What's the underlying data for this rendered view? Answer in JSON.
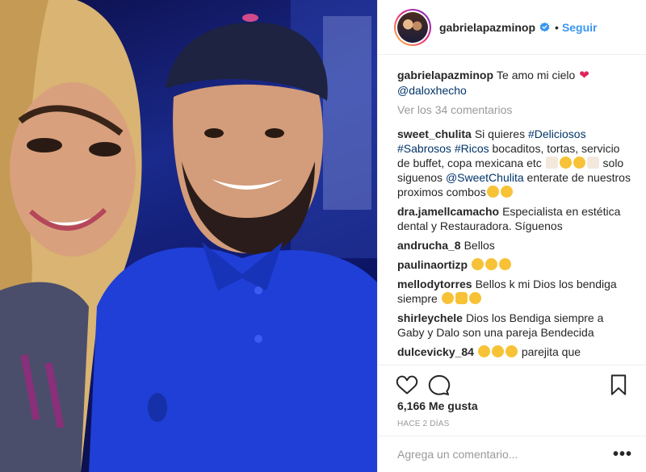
{
  "post": {
    "username": "gabrielapazminop",
    "separator": "•",
    "follow_label": "Seguir",
    "caption_text": "Te amo mi cielo",
    "caption_mention": "@daloxhecho",
    "view_all": "Ver los 34 comentarios",
    "likes": "6,166 Me gusta",
    "time_ago": "HACE 2 DÍAS",
    "add_comment_placeholder": "Agrega un comentario...",
    "more_label": "•••"
  },
  "comments": [
    {
      "user": "sweet_chulita",
      "parts": [
        {
          "t": "text",
          "v": "Si quieres "
        },
        {
          "t": "link",
          "v": "#Deliciosos"
        },
        {
          "t": "text",
          "v": " "
        },
        {
          "t": "link",
          "v": "#Sabrosos"
        },
        {
          "t": "text",
          "v": " "
        },
        {
          "t": "link",
          "v": "#Ricos"
        },
        {
          "t": "text",
          "v": "  bocaditos, tortas, servicio de buffet, copa mexicana etc "
        },
        {
          "t": "emoji",
          "v": "cake"
        },
        {
          "t": "emoji",
          "v": "bowl"
        },
        {
          "t": "emoji",
          "v": "bowl"
        },
        {
          "t": "emoji",
          "v": "cake"
        },
        {
          "t": "text",
          "v": " solo siguenos "
        },
        {
          "t": "link",
          "v": "@SweetChulita"
        },
        {
          "t": "text",
          "v": " enterate de nuestros proximos combos"
        },
        {
          "t": "emoji",
          "v": "smile"
        },
        {
          "t": "emoji",
          "v": "smile"
        }
      ]
    },
    {
      "user": "dra.jamellcamacho",
      "parts": [
        {
          "t": "text",
          "v": "Especialista en estética dental y Restauradora. Síguenos"
        }
      ]
    },
    {
      "user": "andrucha_8",
      "parts": [
        {
          "t": "text",
          "v": "Bellos"
        }
      ]
    },
    {
      "user": "paulinaortizp",
      "parts": [
        {
          "t": "emoji",
          "v": "smile"
        },
        {
          "t": "emoji",
          "v": "smile"
        },
        {
          "t": "emoji",
          "v": "smile"
        }
      ]
    },
    {
      "user": "mellodytorres",
      "parts": [
        {
          "t": "text",
          "v": "Bellos k mi Dios los bendiga siempre "
        },
        {
          "t": "emoji",
          "v": "smile"
        },
        {
          "t": "emoji",
          "v": "thumb"
        },
        {
          "t": "emoji",
          "v": "hearteyes"
        }
      ]
    },
    {
      "user": "shirleychele",
      "parts": [
        {
          "t": "text",
          "v": "Dios los Bendiga siempre a Gaby y Dalo son una pareja Bendecida"
        }
      ]
    },
    {
      "user": "dulcevicky_84",
      "parts": [
        {
          "t": "emoji",
          "v": "hearteyes"
        },
        {
          "t": "emoji",
          "v": "hearteyes"
        },
        {
          "t": "emoji",
          "v": "hearteyes"
        },
        {
          "t": "text",
          "v": " parejita que"
        }
      ]
    }
  ],
  "icons": {
    "like": "heart-outline-icon",
    "comment": "comment-bubble-icon",
    "save": "bookmark-icon",
    "verified": "verified-badge-icon"
  },
  "colors": {
    "link": "#003569",
    "follow": "#3897f0",
    "muted": "#999999",
    "verified": "#3897f0"
  }
}
